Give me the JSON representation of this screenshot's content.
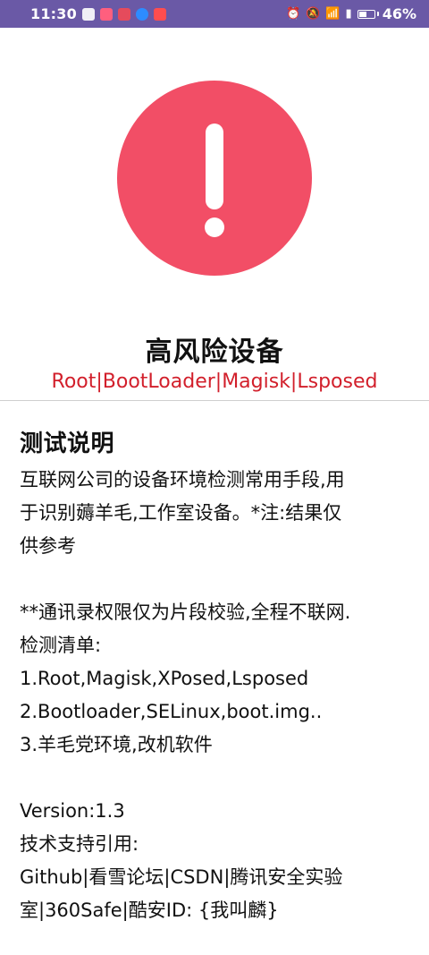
{
  "status_bar": {
    "time": "11:30",
    "battery_percent": "46%",
    "battery_level": 0.46
  },
  "alert": {
    "title": "高风险设备",
    "tags": "Root|BootLoader|Magisk|Lsposed",
    "accent_color": "#f24e66",
    "tags_color": "#d21f2b"
  },
  "description": {
    "heading": "测试说明",
    "body": "互联网公司的设备环境检测常用手段,用\n于识别薅羊毛,工作室设备。*注:结果仅\n供参考\n\n**通讯录权限仅为片段校验,全程不联网.\n检测清单:\n1.Root,Magisk,XPosed,Lsposed\n2.Bootloader,SELinux,boot.img..\n3.羊毛党环境,改机软件\n\nVersion:1.3\n技术支持引用:\nGithub|看雪论坛|CSDN|腾讯安全实验\n室|360Safe|酷安ID: {我叫麟}"
  }
}
